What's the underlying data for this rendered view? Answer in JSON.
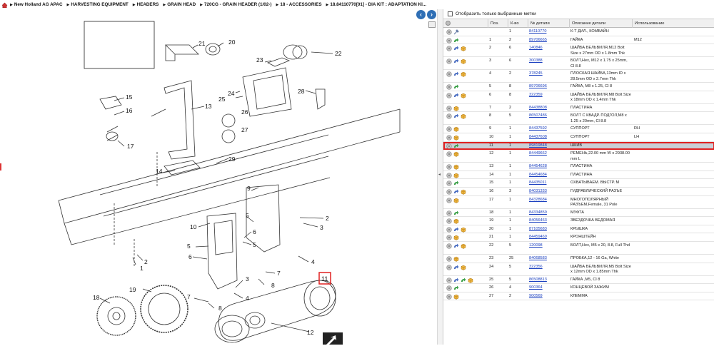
{
  "breadcrumb": [
    "New Holland AG APAC",
    "HARVESTING EQUIPMENT",
    "HEADERS",
    "GRAIN HEAD",
    "720CG - GRAIN HEADER (1/02-)",
    "18 - ACCESSORIES",
    "18.84110770[01] - DIA KIT : ADAPTATION KI..."
  ],
  "filter": {
    "label": "Отобразить только выбранные метки"
  },
  "columns": {
    "pos": "Поз.",
    "qty": "К-во",
    "part": "№ детали",
    "desc": "Описание детали",
    "use": "Использование"
  },
  "diagram_labels": [
    "1",
    "2",
    "3",
    "4",
    "5",
    "6",
    "7",
    "8",
    "9",
    "10",
    "11",
    "12",
    "13",
    "14",
    "15",
    "16",
    "17",
    "18",
    "19",
    "20",
    "21",
    "22",
    "23",
    "24",
    "25",
    "26",
    "27",
    "28",
    "29"
  ],
  "highlight_callout": "11",
  "rows": [
    {
      "icons": [
        "info",
        "wrench"
      ],
      "pos": "",
      "qty": "1",
      "part": "84110770",
      "desc": "К-Т ДИЛ., КОМБАЙН",
      "use": ""
    },
    {
      "icons": [
        "info",
        "arrow-green"
      ],
      "pos": "1",
      "qty": "2",
      "part": "89706665",
      "desc": "ГАЙКА",
      "use": "M12"
    },
    {
      "icons": [
        "info",
        "arrow-blue",
        "box"
      ],
      "pos": "2",
      "qty": "6",
      "part": "140846",
      "desc": "ШАЙБА БЕЛЬВИЛЯ,M12 Bolt Size x 27mm OD x 1.8mm Thk",
      "use": ""
    },
    {
      "icons": [
        "info",
        "arrow-blue",
        "box"
      ],
      "pos": "3",
      "qty": "6",
      "part": "300388",
      "desc": "БОЛТ,Hex, M12 x 1.75 x 25mm, Cl 8.8",
      "use": ""
    },
    {
      "icons": [
        "info",
        "arrow-blue",
        "box"
      ],
      "pos": "4",
      "qty": "2",
      "part": "378245",
      "desc": "ПЛОСКАЯ ШАЙБА,13mm ID x 28.5mm OD x 2.7mm Thk",
      "use": ""
    },
    {
      "icons": [
        "info",
        "arrow-green"
      ],
      "pos": "5",
      "qty": "8",
      "part": "89706696",
      "desc": "ГАЙКА, M8 x 1.25, Cl 8",
      "use": ""
    },
    {
      "icons": [
        "info",
        "arrow-blue",
        "box"
      ],
      "pos": "6",
      "qty": "8",
      "part": "322359",
      "desc": "ШАЙБА БЕЛЬВИЛЯ,M8 Bolt Size x 18mm OD x 1.4mm Thk",
      "use": ""
    },
    {
      "icons": [
        "info",
        "box"
      ],
      "pos": "7",
      "qty": "2",
      "part": "84438808",
      "desc": "ПЛАСТИНА",
      "use": ""
    },
    {
      "icons": [
        "info",
        "arrow-blue",
        "box"
      ],
      "pos": "8",
      "qty": "5",
      "part": "86507486",
      "desc": "БОЛТ С КВАДР. ПОДГОЛ,M8 x 1.25 x 20mm, Cl 8.8",
      "use": ""
    },
    {
      "icons": [
        "info",
        "box"
      ],
      "pos": "9",
      "qty": "1",
      "part": "84437592",
      "desc": "СУППОРТ",
      "use": "RH"
    },
    {
      "icons": [
        "info",
        "box"
      ],
      "pos": "10",
      "qty": "1",
      "part": "84437608",
      "desc": "СУППОРТ",
      "use": "LH"
    },
    {
      "icons": [
        "info",
        "arrow-green"
      ],
      "pos": "11",
      "qty": "1",
      "part": "89819848",
      "desc": "ШКИВ",
      "use": "",
      "selected": true
    },
    {
      "icons": [
        "info",
        "box"
      ],
      "pos": "12",
      "qty": "1",
      "part": "84449662",
      "desc": "РЕМЕНЬ,22.00 mm W x 2938.00 mm L",
      "use": ""
    },
    {
      "icons": [
        "info",
        "box"
      ],
      "pos": "13",
      "qty": "1",
      "part": "84454628",
      "desc": "ПЛАСТИНА",
      "use": ""
    },
    {
      "icons": [
        "info",
        "box"
      ],
      "pos": "14",
      "qty": "1",
      "part": "84454684",
      "desc": "ПЛАСТИНА",
      "use": ""
    },
    {
      "icons": [
        "info",
        "arrow-green"
      ],
      "pos": "15",
      "qty": "1",
      "part": "84435011",
      "desc": "ОХВАТЫВАЕМ. ВЫСТР. М",
      "use": ""
    },
    {
      "icons": [
        "info",
        "arrow-blue",
        "box"
      ],
      "pos": "16",
      "qty": "3",
      "part": "84031333",
      "desc": "ГИДРАВЛИЧЕСКИЙ РАЗЪЕ",
      "use": ""
    },
    {
      "icons": [
        "info",
        "box"
      ],
      "pos": "17",
      "qty": "1",
      "part": "84328684",
      "desc": "МНОГОПОЛЯРНЫЙ РАЗЪЕМ,Female, 31 Pole",
      "use": ""
    },
    {
      "icons": [
        "info",
        "arrow-green"
      ],
      "pos": "18",
      "qty": "1",
      "part": "84334859",
      "desc": "МУФТА",
      "use": ""
    },
    {
      "icons": [
        "info",
        "box"
      ],
      "pos": "19",
      "qty": "1",
      "part": "84056463",
      "desc": "ЗВЕЗДОЧКА ВЕДОМАЯ",
      "use": ""
    },
    {
      "icons": [
        "info",
        "arrow-blue",
        "box"
      ],
      "pos": "20",
      "qty": "1",
      "part": "87105683",
      "desc": "КРЫШКА",
      "use": ""
    },
    {
      "icons": [
        "info",
        "box"
      ],
      "pos": "21",
      "qty": "1",
      "part": "84459469",
      "desc": "КРОНШТЕЙН",
      "use": ""
    },
    {
      "icons": [
        "info",
        "arrow-blue",
        "box"
      ],
      "pos": "22",
      "qty": "5",
      "part": "120098",
      "desc": "БОЛТ,Hex, M5 x 20, 8.8, Full Thd",
      "use": ""
    },
    {
      "icons": [
        "info",
        "box"
      ],
      "pos": "23",
      "qty": "25",
      "part": "84068583",
      "desc": "ПРОБКА,12 - 16 Ga, White",
      "use": ""
    },
    {
      "icons": [
        "info",
        "arrow-blue",
        "box"
      ],
      "pos": "24",
      "qty": "5",
      "part": "322356",
      "desc": "ШАЙБА БЕЛЬВИЛЯ,M5 Bolt Size x 12mm OD x 1.85mm Thk",
      "use": ""
    },
    {
      "icons": [
        "info",
        "arrow-blue",
        "arrow-green",
        "box"
      ],
      "pos": "25",
      "qty": "5",
      "part": "86508813",
      "desc": "ГАЙКА ,M5, Cl 8",
      "use": ""
    },
    {
      "icons": [
        "info",
        "arrow-green"
      ],
      "pos": "26",
      "qty": "4",
      "part": "900364",
      "desc": "КОНЦЕВОЙ ЗАЖИМ",
      "use": ""
    },
    {
      "icons": [
        "info",
        "box"
      ],
      "pos": "27",
      "qty": "2",
      "part": "900569",
      "desc": "КЛЕММА",
      "use": ""
    }
  ]
}
